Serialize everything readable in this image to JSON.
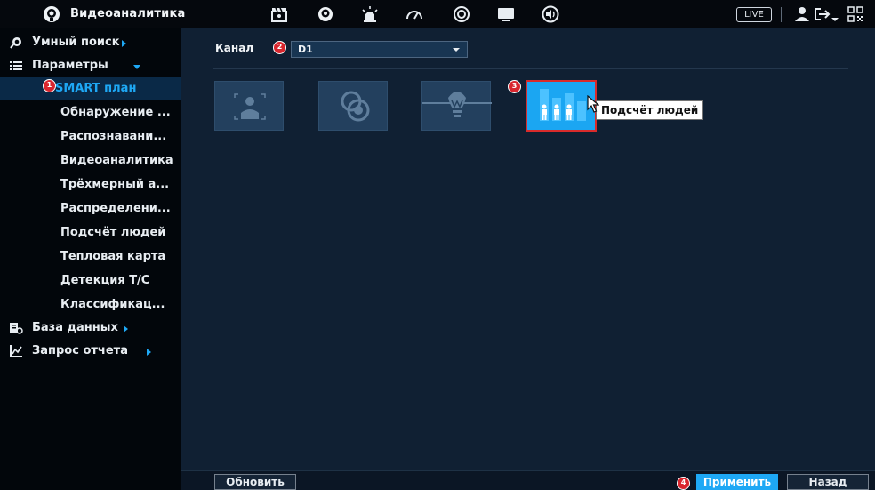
{
  "topbar": {
    "title": "Видеоаналитика",
    "icons": [
      "analytics-head-icon",
      "clapperboard-icon",
      "smart-head-icon",
      "alarm-icon",
      "gauge-icon",
      "refresh-circle-icon",
      "monitor-icon",
      "speaker-icon",
      "user-icon",
      "logout-icon",
      "qr-code-icon"
    ],
    "live_label": "LIVE"
  },
  "sidebar": {
    "items": [
      {
        "label": "Умный поиск",
        "icon": "smart-search-icon"
      },
      {
        "label": "Параметры",
        "icon": "list-icon"
      },
      {
        "label": "База данных",
        "icon": "database-icon"
      },
      {
        "label": "Запрос отчета",
        "icon": "report-chart-icon"
      }
    ],
    "sub_items": [
      {
        "label": "SMART план"
      },
      {
        "label": "Обнаружение ..."
      },
      {
        "label": "Распознавани..."
      },
      {
        "label": "Видеоаналитика"
      },
      {
        "label": "Трёхмерный а..."
      },
      {
        "label": "Распределени..."
      },
      {
        "label": "Подсчёт людей"
      },
      {
        "label": "Тепловая карта"
      },
      {
        "label": "Детекция Т/С"
      },
      {
        "label": "Классификац..."
      }
    ]
  },
  "main": {
    "channel_label": "Канал",
    "channel_value": "D1",
    "tiles": [
      {
        "icon": "face-detection-icon",
        "selected": false
      },
      {
        "icon": "video-structure-icon",
        "selected": false
      },
      {
        "icon": "ivs-lamp-icon",
        "selected": false
      },
      {
        "icon": "people-counting-icon",
        "selected": true
      }
    ],
    "tooltip": "Подсчёт людей"
  },
  "bottom": {
    "refresh_label": "Обновить",
    "apply_label": "Применить",
    "back_label": "Назад"
  },
  "markers": [
    "1",
    "2",
    "3",
    "4"
  ],
  "colors": {
    "accent": "#1ea8f5",
    "marker": "#d8262e",
    "sidebar_bg": "#02060b",
    "main_bg": "#102033",
    "topbar_bg": "#05080d"
  }
}
